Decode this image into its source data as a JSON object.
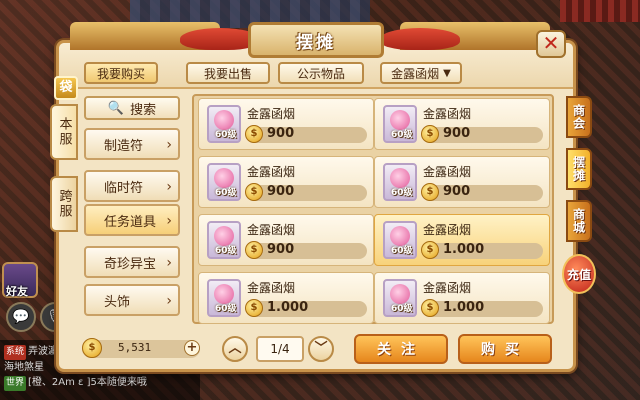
{
  "window": {
    "title": "摆摊"
  },
  "top_tabs": [
    {
      "label": "我要购买",
      "active": true
    },
    {
      "label": "我要出售",
      "active": false
    },
    {
      "label": "公示物品",
      "active": false
    },
    {
      "label": "金露函烟",
      "active": false,
      "dropdown": true
    }
  ],
  "server_tabs": [
    {
      "label": "本服",
      "active": true
    },
    {
      "label": "跨服",
      "active": false
    }
  ],
  "search": {
    "label": "搜索"
  },
  "categories": [
    {
      "label": "制造符",
      "active": false
    },
    {
      "label": "临时符",
      "active": false
    },
    {
      "label": "任务道具",
      "active": true
    },
    {
      "label": "奇珍异宝",
      "active": false
    },
    {
      "label": "头饰",
      "active": false
    }
  ],
  "items": [
    {
      "name": "金露函烟",
      "level": "60级",
      "price": "900",
      "active": false
    },
    {
      "name": "金露函烟",
      "level": "60级",
      "price": "900",
      "active": false
    },
    {
      "name": "金露函烟",
      "level": "60级",
      "price": "900",
      "active": false
    },
    {
      "name": "金露函烟",
      "level": "60级",
      "price": "900",
      "active": false
    },
    {
      "name": "金露函烟",
      "level": "60级",
      "price": "900",
      "active": false
    },
    {
      "name": "金露函烟",
      "level": "60级",
      "price": "1.000",
      "active": true
    },
    {
      "name": "金露函烟",
      "level": "60级",
      "price": "1.000",
      "active": false
    },
    {
      "name": "金露函烟",
      "level": "60级",
      "price": "1.000",
      "active": false
    }
  ],
  "money": {
    "value": "5,531"
  },
  "pagination": {
    "current": "1/4"
  },
  "actions": {
    "follow": "关注",
    "buy": "购买"
  },
  "side_tabs": [
    {
      "label": "商会",
      "active": false
    },
    {
      "label": "摆摊",
      "active": true
    },
    {
      "label": "商城",
      "active": false
    }
  ],
  "recharge": {
    "label": "充值"
  },
  "hud": {
    "friend_label": "好友"
  },
  "chat": [
    {
      "tag": "系统",
      "text": "弄波瀛"
    },
    {
      "tag": "",
      "text": "海地煞星"
    },
    {
      "tag": "世界",
      "text": "[橙、2Am ε ]5本随便来哦"
    }
  ],
  "colors": {
    "accent": "#f0a030",
    "panel_bg": "#f3e4c4",
    "border": "#c7924a",
    "close": "#c0281c"
  }
}
